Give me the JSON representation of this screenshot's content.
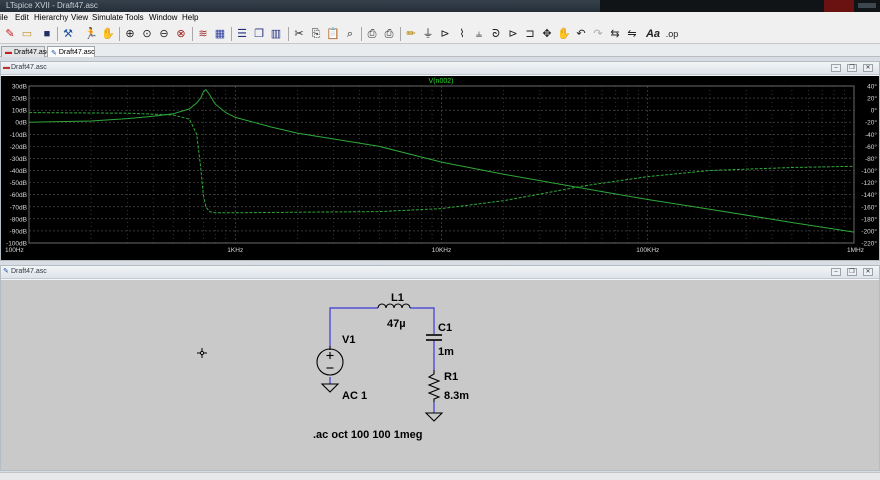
{
  "titlebar": {
    "title": "LTspice XVII - Draft47.asc"
  },
  "menu": [
    "ile",
    "Edit",
    "Hierarchy",
    "View",
    "Simulate",
    "Tools",
    "Window",
    "Help"
  ],
  "doc_tabs": [
    {
      "label": "Draft47.asc",
      "active": false
    },
    {
      "label": "Draft47.asc",
      "active": true
    }
  ],
  "plot_window": {
    "title": "Draft47.asc"
  },
  "schematic_window": {
    "title": "Draft47.asc"
  },
  "chart_data": {
    "type": "line",
    "title": "V(n002)",
    "x_scale": "log",
    "xlim": [
      100,
      1000000
    ],
    "x_ticks": [
      {
        "value": 100,
        "label": "100Hz"
      },
      {
        "value": 1000,
        "label": "1KHz"
      },
      {
        "value": 10000,
        "label": "10KHz"
      },
      {
        "value": 100000,
        "label": "100KHz"
      },
      {
        "value": 1000000,
        "label": "1MHz"
      }
    ],
    "y_left_ticks": [
      "30dB",
      "20dB",
      "10dB",
      "0dB",
      "-10dB",
      "-20dB",
      "-30dB",
      "-40dB",
      "-50dB",
      "-60dB",
      "-70dB",
      "-80dB",
      "-90dB",
      "-100dB"
    ],
    "y_left_lim": [
      -100,
      30
    ],
    "y_right_ticks": [
      "40°",
      "20°",
      "0°",
      "-20°",
      "-40°",
      "-60°",
      "-80°",
      "-100°",
      "-120°",
      "-140°",
      "-160°",
      "-180°",
      "-200°",
      "-220°"
    ],
    "y_right_lim": [
      -220,
      40
    ],
    "grid": true,
    "series": [
      {
        "kind": "magnitude",
        "axis": "left",
        "x": [
          100,
          200,
          300,
          400,
          500,
          600,
          650,
          680,
          700,
          720,
          750,
          800,
          900,
          1000,
          1500,
          2000,
          5000,
          10000,
          20000,
          50000,
          100000,
          200000,
          500000,
          1000000
        ],
        "y": [
          0,
          1,
          3,
          5,
          7,
          11,
          16,
          20,
          25,
          27,
          23,
          15,
          8,
          4,
          -4,
          -9,
          -20,
          -33,
          -43,
          -55,
          -64,
          -72,
          -83,
          -91
        ]
      },
      {
        "kind": "phase",
        "axis": "right",
        "x": [
          100,
          300,
          500,
          600,
          650,
          680,
          700,
          720,
          750,
          800,
          1000,
          2000,
          5000,
          10000,
          20000,
          50000,
          100000,
          200000,
          500000,
          1000000
        ],
        "y": [
          -4,
          -5,
          -8,
          -15,
          -40,
          -95,
          -140,
          -160,
          -168,
          -170,
          -170,
          -169,
          -168,
          -163,
          -150,
          -125,
          -110,
          -100,
          -95,
          -93
        ]
      }
    ]
  },
  "schematic": {
    "components": [
      {
        "ref": "L1",
        "value": "47µ"
      },
      {
        "ref": "C1",
        "value": "1m"
      },
      {
        "ref": "V1",
        "value": "AC 1"
      },
      {
        "ref": "R1",
        "value": "8.3m"
      }
    ],
    "directive": ".ac oct 100 100 1meg"
  },
  "colors": {
    "plot_background": "#000000",
    "grid": "#5a5a5a",
    "trace": "#2fa83a",
    "trace_title": "#22dd22",
    "wire": "#3a3ad8",
    "schematic_background": "#c9c9c9"
  }
}
